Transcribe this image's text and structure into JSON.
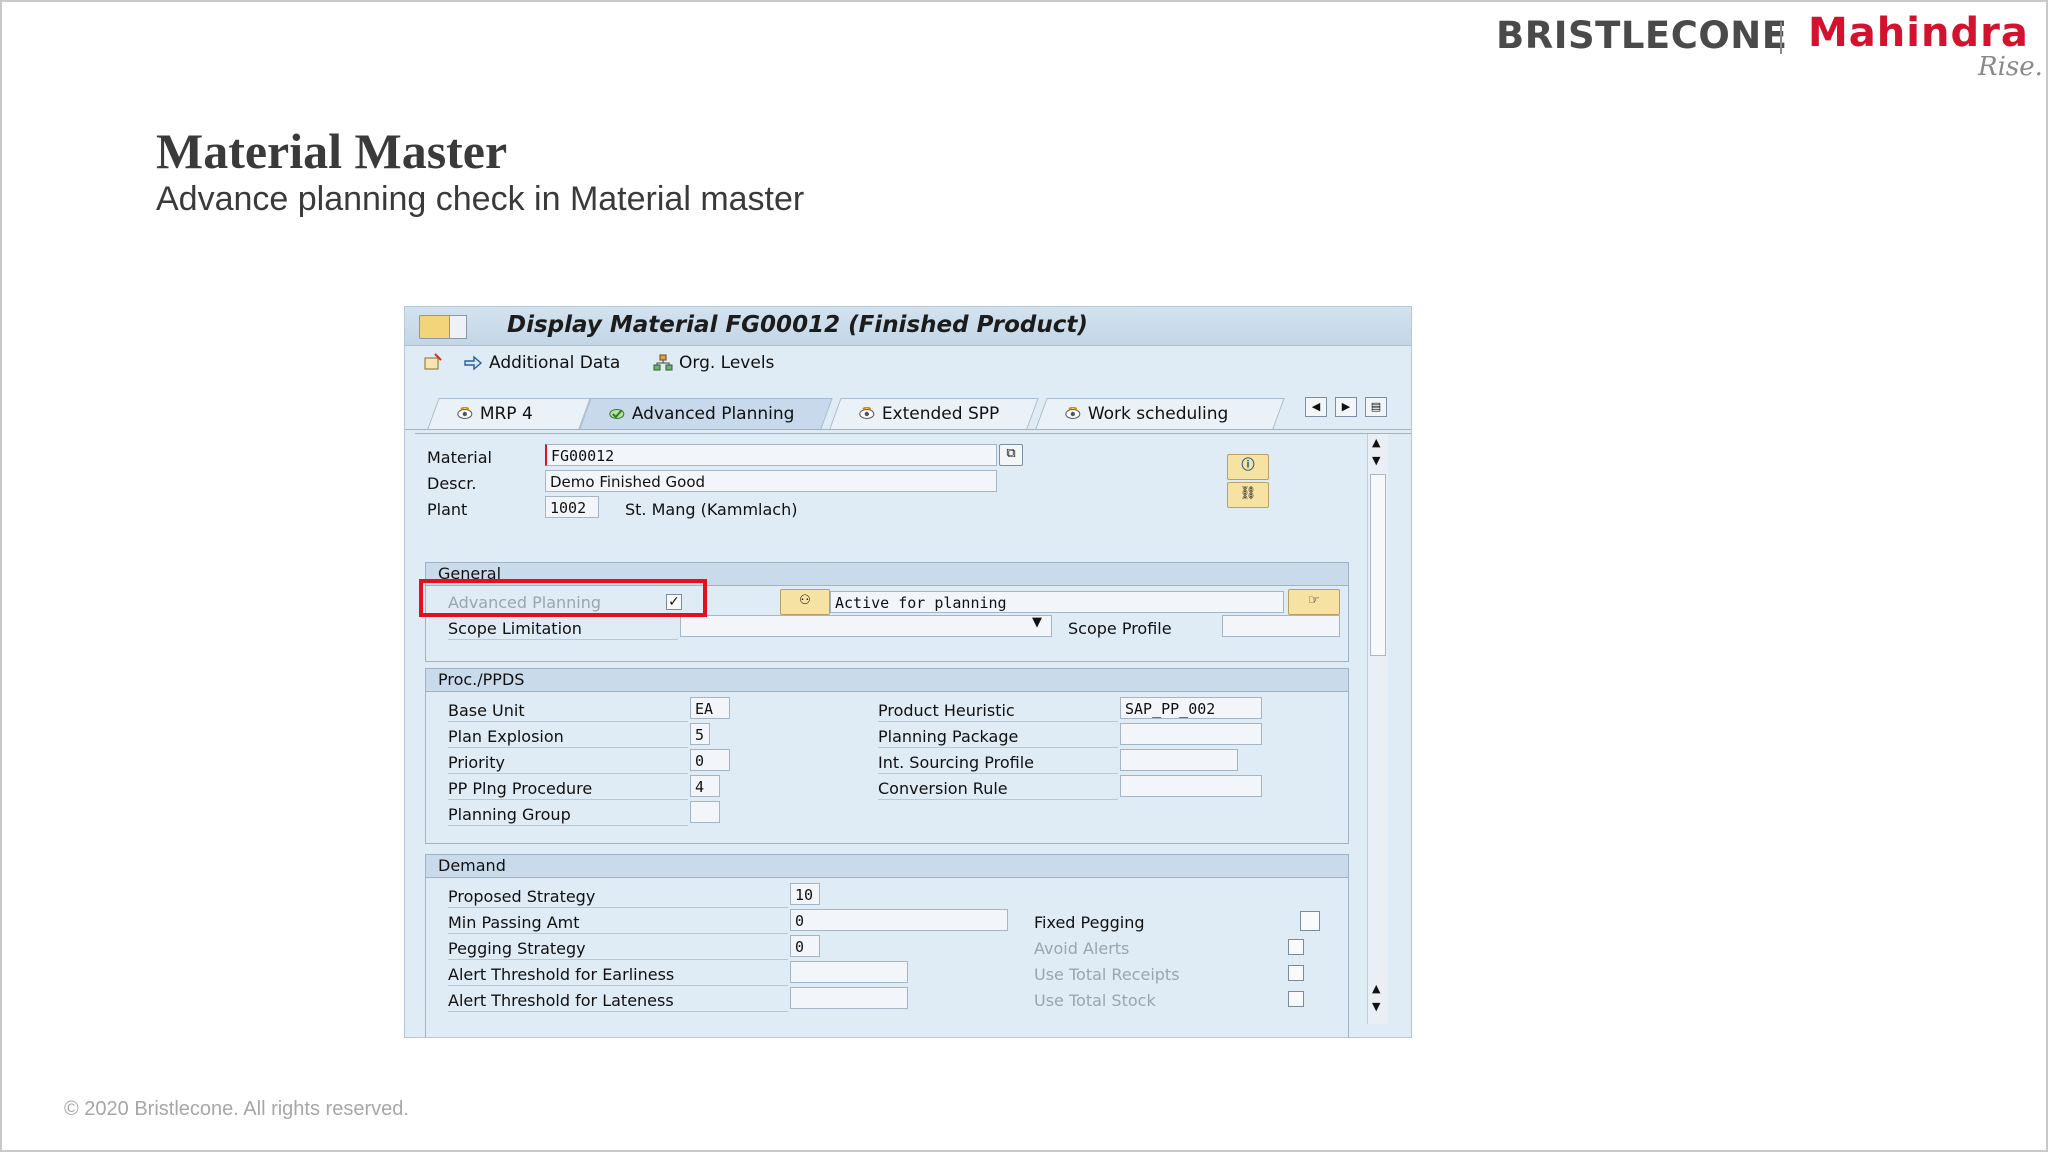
{
  "branding": {
    "bristlecone": "BRISTLECONE",
    "mahindra": "Mahindra",
    "rise": "Rise."
  },
  "slide": {
    "title": "Material Master",
    "subtitle": "Advance planning check in Material master"
  },
  "footer": "© 2020 Bristlecone. All rights reserved.",
  "window": {
    "title": "Display Material FG00012 (Finished Product)",
    "toolbar": {
      "additional_data": "Additional Data",
      "org_levels": "Org. Levels"
    },
    "tabs": [
      {
        "label": "MRP 4"
      },
      {
        "label": "Advanced Planning"
      },
      {
        "label": "Extended SPP"
      },
      {
        "label": "Work scheduling"
      }
    ],
    "header": {
      "material_label": "Material",
      "material_value": "FG00012",
      "descr_label": "Descr.",
      "descr_value": "Demo Finished Good",
      "plant_label": "Plant",
      "plant_value": "1002",
      "plant_name": "St. Mang (Kammlach)"
    },
    "general": {
      "heading": "General",
      "advanced_planning_label": "Advanced Planning",
      "advanced_planning_checked": true,
      "status_value": "Active for planning",
      "scope_limitation_label": "Scope Limitation",
      "scope_profile_label": "Scope Profile"
    },
    "proc_ppds": {
      "heading": "Proc./PPDS",
      "base_unit_label": "Base Unit",
      "base_unit_value": "EA",
      "plan_explosion_label": "Plan Explosion",
      "plan_explosion_value": "5",
      "priority_label": "Priority",
      "priority_value": "0",
      "pp_plng_label": "PP Plng Procedure",
      "pp_plng_value": "4",
      "planning_group_label": "Planning Group",
      "product_heuristic_label": "Product Heuristic",
      "product_heuristic_value": "SAP_PP_002",
      "planning_package_label": "Planning Package",
      "int_sourcing_label": "Int. Sourcing Profile",
      "conversion_rule_label": "Conversion Rule"
    },
    "demand": {
      "heading": "Demand",
      "proposed_strategy_label": "Proposed Strategy",
      "proposed_strategy_value": "10",
      "min_passing_label": "Min Passing Amt",
      "min_passing_value": "0",
      "pegging_strategy_label": "Pegging Strategy",
      "pegging_strategy_value": "0",
      "alert_earliness_label": "Alert Threshold for Earliness",
      "alert_lateness_label": "Alert Threshold for Lateness",
      "fixed_pegging_label": "Fixed Pegging",
      "avoid_alerts_label": "Avoid Alerts",
      "use_total_receipts_label": "Use Total Receipts",
      "use_total_stock_label": "Use Total Stock"
    }
  }
}
